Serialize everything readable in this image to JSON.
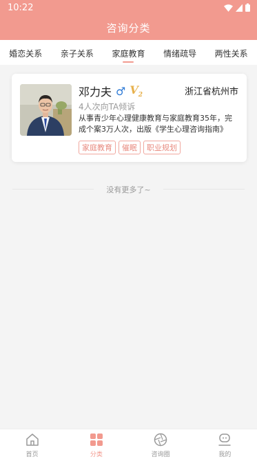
{
  "status_bar": {
    "time": "10:22"
  },
  "header": {
    "title": "咨询分类"
  },
  "tabs": [
    {
      "label": "婚恋关系",
      "active": false
    },
    {
      "label": "亲子关系",
      "active": false
    },
    {
      "label": "家庭教育",
      "active": true
    },
    {
      "label": "情绪疏导",
      "active": false
    },
    {
      "label": "两性关系",
      "active": false
    }
  ],
  "counselor": {
    "name": "邓力夫",
    "gender_symbol": "♂",
    "level": "V",
    "level_sub": "2",
    "city": "浙江省杭州市",
    "consult_count": "4人次向TA倾诉",
    "description": "从事青少年心理健康教育与家庭教育35年，完成个案3万人次，出版《学生心理咨询指南》",
    "tags": [
      "家庭教育",
      "催眠",
      "职业规划"
    ]
  },
  "list_end_text": "没有更多了~",
  "bottom_nav": [
    {
      "label": "首页",
      "icon": "home-icon",
      "active": false
    },
    {
      "label": "分类",
      "icon": "category-icon",
      "active": true
    },
    {
      "label": "咨询圈",
      "icon": "aperture-icon",
      "active": false
    },
    {
      "label": "我的",
      "icon": "profile-icon",
      "active": false
    }
  ],
  "colors": {
    "accent": "#f29a8f",
    "tag": "#e88a7f",
    "gender": "#2f7bd6",
    "level": "#e7b14d"
  }
}
